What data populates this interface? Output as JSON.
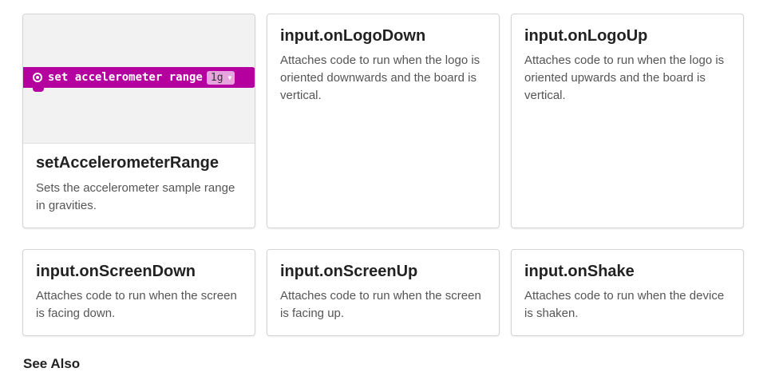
{
  "cards": [
    {
      "title": "setAccelerometerRange",
      "description": "Sets the accelerometer sample range in gravities.",
      "block": {
        "text": "set accelerometer range",
        "dropdown_value": "1g",
        "dropdown_icon": "caret-down-icon",
        "block_icon": "accelerometer-icon",
        "color": "#b3009f"
      }
    },
    {
      "title": "input.onLogoDown",
      "description": "Attaches code to run when the logo is oriented downwards and the board is vertical."
    },
    {
      "title": "input.onLogoUp",
      "description": "Attaches code to run when the logo is oriented upwards and the board is vertical."
    },
    {
      "title": "input.onScreenDown",
      "description": "Attaches code to run when the screen is facing down."
    },
    {
      "title": "input.onScreenUp",
      "description": "Attaches code to run when the screen is facing up."
    },
    {
      "title": "input.onShake",
      "description": "Attaches code to run when the device is shaken."
    }
  ],
  "see_also": "See Also"
}
